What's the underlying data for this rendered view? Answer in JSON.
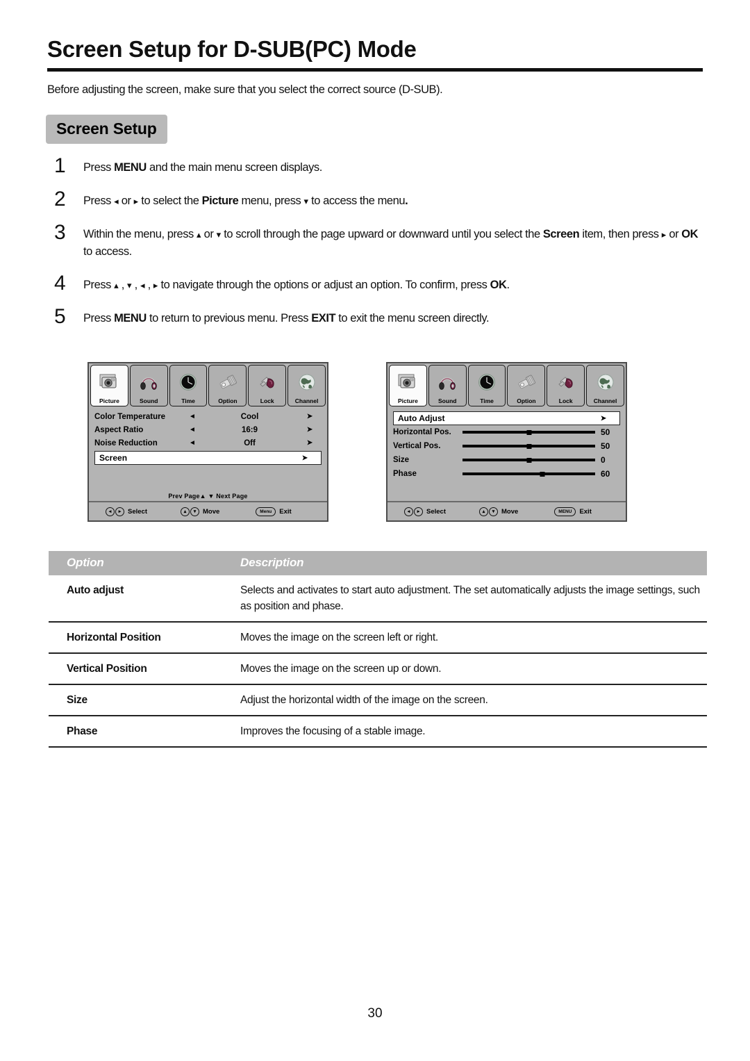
{
  "document": {
    "title": "Screen Setup for D-SUB(PC) Mode",
    "intro": "Before adjusting the screen, make sure that you select the correct source (D-SUB).",
    "section_label": "Screen Setup",
    "page_number": "30"
  },
  "steps": [
    {
      "number": "1",
      "parts": [
        {
          "t": "Press ",
          "b": false
        },
        {
          "t": "MENU",
          "b": true
        },
        {
          "t": " and the main menu screen displays.",
          "b": false
        }
      ]
    },
    {
      "number": "2",
      "parts": [
        {
          "t": "Press ",
          "b": false
        },
        {
          "t": "◂",
          "b": false
        },
        {
          "t": " or ",
          "b": false
        },
        {
          "t": "▸",
          "b": false
        },
        {
          "t": " to select the  ",
          "b": false
        },
        {
          "t": "Picture",
          "b": true
        },
        {
          "t": " menu,  press ",
          "b": false
        },
        {
          "t": "▾",
          "b": false
        },
        {
          "t": " to access the menu",
          "b": false
        },
        {
          "t": ".",
          "b": true
        }
      ]
    },
    {
      "number": "3",
      "parts": [
        {
          "t": "Within the menu, press ",
          "b": false
        },
        {
          "t": "▴",
          "b": false
        },
        {
          "t": " or ",
          "b": false
        },
        {
          "t": "▾",
          "b": false
        },
        {
          "t": " to scroll through the page upward or downward until you select the ",
          "b": false
        },
        {
          "t": "Screen",
          "b": true
        },
        {
          "t": " item, then press  ",
          "b": false
        },
        {
          "t": "▸",
          "b": false
        },
        {
          "t": " or ",
          "b": false
        },
        {
          "t": "OK",
          "b": true
        },
        {
          "t": " to access.",
          "b": false
        }
      ]
    },
    {
      "number": "4",
      "parts": [
        {
          "t": "Press ",
          "b": false
        },
        {
          "t": "▴",
          "b": false
        },
        {
          "t": " , ",
          "b": false
        },
        {
          "t": "▾",
          "b": false
        },
        {
          "t": " , ",
          "b": false
        },
        {
          "t": "◂",
          "b": false
        },
        {
          "t": " , ",
          "b": false
        },
        {
          "t": "▸",
          "b": false
        },
        {
          "t": " to navigate through the options or adjust an option. To confirm, press ",
          "b": false
        },
        {
          "t": "OK",
          "b": true
        },
        {
          "t": ".",
          "b": false
        }
      ]
    },
    {
      "number": "5",
      "parts": [
        {
          "t": "Press ",
          "b": false
        },
        {
          "t": "MENU",
          "b": true
        },
        {
          "t": " to return to previous menu. Press ",
          "b": false
        },
        {
          "t": "EXIT",
          "b": true
        },
        {
          "t": " to exit the menu screen directly.",
          "b": false
        }
      ]
    }
  ],
  "osd_tabs": [
    {
      "label": "Picture",
      "icon": "camera-icon",
      "active": true
    },
    {
      "label": "Sound",
      "icon": "headphones-icon",
      "active": false
    },
    {
      "label": "Time",
      "icon": "clock-icon",
      "active": false
    },
    {
      "label": "Option",
      "icon": "connector-icon",
      "active": false
    },
    {
      "label": "Lock",
      "icon": "padlock-icon",
      "active": false
    },
    {
      "label": "Channel",
      "icon": "globe-icon",
      "active": false
    }
  ],
  "osd_left": {
    "rows": [
      {
        "label": "Color Temperature",
        "left_arrow": "◄",
        "value": "Cool",
        "right_arrow": "➤"
      },
      {
        "label": "Aspect Ratio",
        "left_arrow": "◄",
        "value": "16:9",
        "right_arrow": "➤"
      },
      {
        "label": "Noise Reduction",
        "left_arrow": "◄",
        "value": "Off",
        "right_arrow": "➤"
      }
    ],
    "selected_row": {
      "label": "Screen",
      "right_arrow": "➤"
    },
    "pager": "Prev  Page▲  ▼ Next  Page",
    "footer": [
      {
        "keys": [
          "◂",
          "▸"
        ],
        "style": "circle-pair",
        "label": "Select"
      },
      {
        "keys": [
          "▴",
          "▾"
        ],
        "style": "circle-pair",
        "label": "Move"
      },
      {
        "keys": [
          "Menu"
        ],
        "style": "pill",
        "label": "Exit"
      }
    ]
  },
  "osd_right": {
    "selected_row": {
      "label": "Auto Adjust",
      "right_arrow": "➤"
    },
    "sliders": [
      {
        "label": "Horizontal Pos.",
        "value": "50",
        "percent": 50
      },
      {
        "label": "Vertical Pos.",
        "value": "50",
        "percent": 50
      },
      {
        "label": "Size",
        "value": "0",
        "percent": 50
      },
      {
        "label": "Phase",
        "value": "60",
        "percent": 60
      }
    ],
    "footer": [
      {
        "keys": [
          "◂",
          "▸"
        ],
        "style": "circle-pair",
        "label": "Select"
      },
      {
        "keys": [
          "▴",
          "▾"
        ],
        "style": "circle-pair",
        "label": "Move"
      },
      {
        "keys": [
          "MENU"
        ],
        "style": "pill",
        "label": "Exit"
      }
    ]
  },
  "option_table": {
    "headers": [
      "Option",
      "Description"
    ],
    "rows": [
      {
        "option": "Auto adjust",
        "description": "Selects and activates to start auto adjustment. The set automatically adjusts the image settings, such as position and phase."
      },
      {
        "option": "Horizontal Position",
        "description": "Moves the image on the screen left or right."
      },
      {
        "option": "Vertical Position",
        "description": "Moves the image on the screen up or down."
      },
      {
        "option": "Size",
        "description": "Adjust the horizontal width of the image on the screen."
      },
      {
        "option": "Phase",
        "description": "Improves the focusing of a stable image."
      }
    ]
  },
  "colors": {
    "section_chip_bg": "#b9b9b9",
    "table_header_bg": "#b3b3b3",
    "osd_bg": "#b4b4b4",
    "osd_selected_bg": "#ffffff",
    "rule": "#111111"
  }
}
